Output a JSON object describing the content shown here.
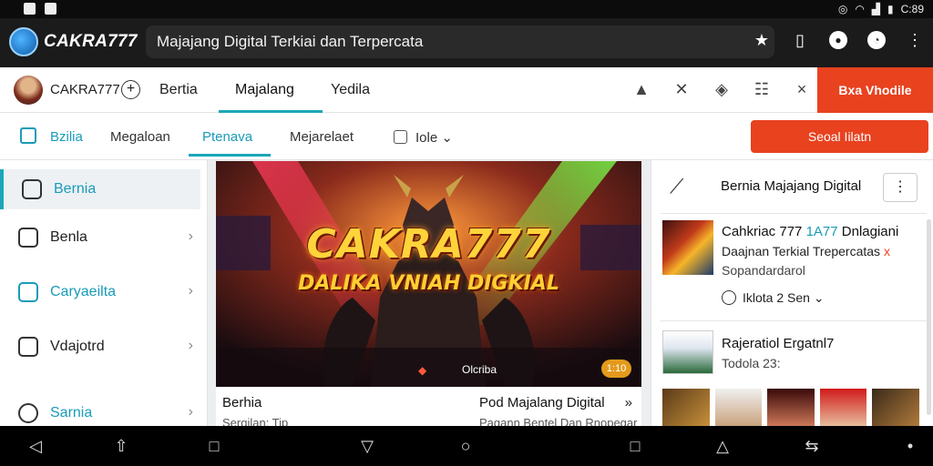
{
  "status_bar": {
    "clock": "C:89"
  },
  "browser": {
    "logo_text": "CAKRA777",
    "url_title": "Majajang Digital Terkiai dan Terpercata",
    "icons": [
      "star-icon",
      "bookmark-icon",
      "notifications-icon",
      "account-icon",
      "more-vert-icon"
    ]
  },
  "header": {
    "brand": "CAKRA777",
    "tabs": [
      {
        "label": "Bertia"
      },
      {
        "label": "Majalang"
      },
      {
        "label": "Yedila"
      }
    ],
    "icons": [
      "bell-icon",
      "pin-icon",
      "alert-icon",
      "grid-icon",
      "close-icon"
    ],
    "cta_label": "Bxa Vhodile",
    "accent": "#1aa7b8",
    "cta_color": "#e8421f"
  },
  "subnav": {
    "items": [
      {
        "label": "Bzilia"
      },
      {
        "label": "Megaloan"
      },
      {
        "label": "Ptenava"
      },
      {
        "label": "Mejarelaet"
      },
      {
        "label": "Iole"
      }
    ],
    "button_label": "Seoal Iilatn"
  },
  "sidebar": {
    "items": [
      {
        "label": "Bernia",
        "icon": "book-icon"
      },
      {
        "label": "Benla",
        "icon": "document-icon"
      },
      {
        "label": "Caryaeilta",
        "icon": "tag-icon"
      },
      {
        "label": "Vdajotrd",
        "icon": "chart-icon"
      },
      {
        "label": "Sarnia",
        "icon": "globe-icon"
      }
    ]
  },
  "hero": {
    "title": "CAKRA777",
    "subtitle": "DALIKA VNIAH DIGKIAL",
    "badge": "Olcriba",
    "pill": "1:10",
    "footer_left": "Berhia",
    "footer_right": "Pod Majalang Digital",
    "footer_left_sub": "Sergilan: Tip",
    "footer_right_sub": "Pagann Bentel Dan Rnopegar"
  },
  "right_panel": {
    "title": "Bernia Majajang Digital",
    "item1_title_prefix": "Cahkriac 777 ",
    "item1_title_accent": "1A77",
    "item1_title_suffix": " Dnlagiani",
    "item1_line2": "Daajnan Terkial Trepercatas",
    "item1_line2_mark": "x",
    "item1_line3": "Sopandardarol",
    "item1_meta": "Iklota 2 Sen",
    "item2_title": "Rajeratiol Ergatnl7",
    "item2_sub": "Todola 23:"
  }
}
